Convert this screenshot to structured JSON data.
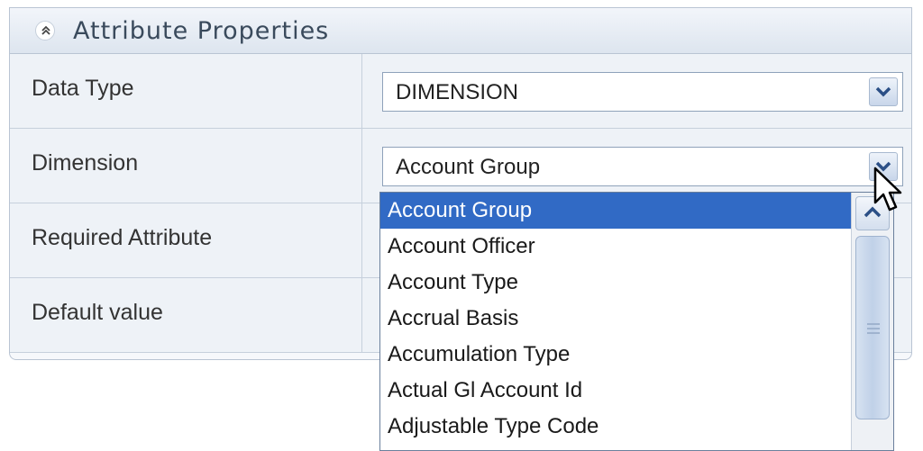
{
  "panel": {
    "title": "Attribute Properties",
    "collapse_icon": "double-chevron-up-icon"
  },
  "rows": [
    {
      "label": "Data Type",
      "value": "DIMENSION"
    },
    {
      "label": "Dimension",
      "value": "Account Group"
    },
    {
      "label": "Required Attribute",
      "value": ""
    },
    {
      "label": "Default value",
      "value": ""
    }
  ],
  "dropdown": {
    "open": true,
    "selected_index": 0,
    "options": [
      "Account Group",
      "Account Officer",
      "Account Type",
      "Accrual Basis",
      "Accumulation Type",
      "Actual Gl Account Id",
      "Adjustable Type Code"
    ]
  },
  "colors": {
    "selection": "#316ac5",
    "panel_header": "#dde5ef",
    "border": "#b9c4d3"
  },
  "icons": {
    "select_arrow": "chevron-down-icon",
    "scroll_up": "chevron-up-icon",
    "cursor": "mouse-pointer-icon"
  }
}
